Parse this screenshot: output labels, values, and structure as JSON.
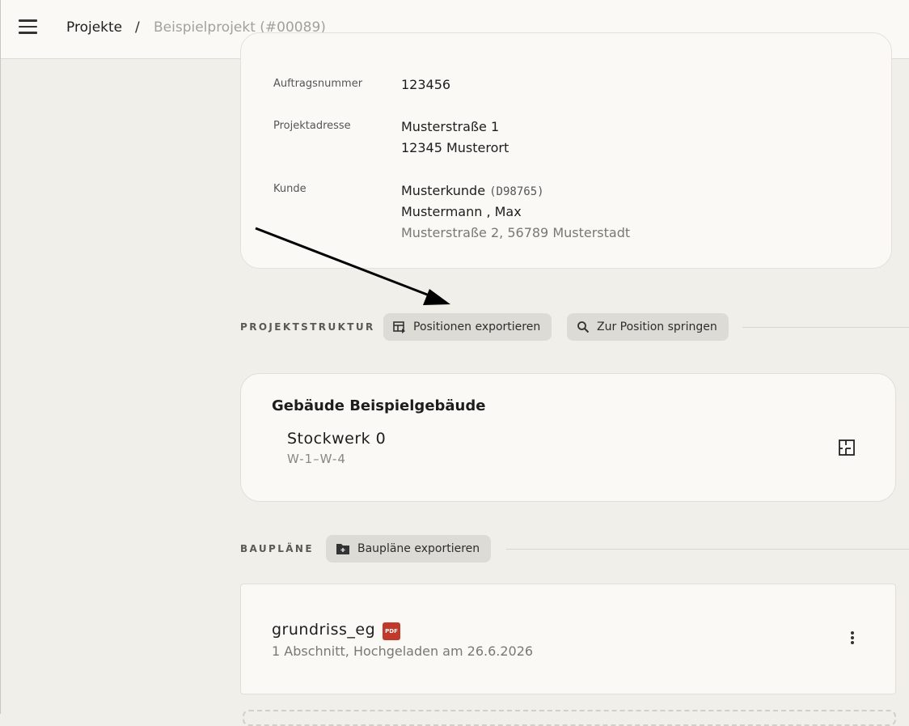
{
  "header": {
    "breadcrumb_home": "Projekte",
    "breadcrumb_separator": "/",
    "breadcrumb_current": "Beispielprojekt (#00089)"
  },
  "project_info": {
    "order_number_label": "Auftragsnummer",
    "order_number": "123456",
    "address_label": "Projektadresse",
    "address_line1": "Musterstraße 1",
    "address_line2": "12345 Musterort",
    "customer_label": "Kunde",
    "customer_name": "Musterkunde",
    "customer_id": "(D98765)",
    "contact": "Mustermann , Max",
    "customer_address": "Musterstraße 2, 56789 Musterstadt"
  },
  "structure": {
    "section_label": "PROJEKTSTRUKTUR",
    "export_button": "Positionen exportieren",
    "jump_button": "Zur Position springen",
    "building_title": "Gebäude Beispielgebäude",
    "floor_name": "Stockwerk 0",
    "floor_range": "W-1–W-4"
  },
  "plans": {
    "section_label": "BAUPLÄNE",
    "export_button": "Baupläne exportieren",
    "items": [
      {
        "name": "grundriss_eg",
        "file_type": "PDF",
        "meta": "1 Abschnitt, Hochgeladen am 26.6.2026"
      }
    ]
  },
  "colors": {
    "background": "#f1efea",
    "card": "#faf9f6",
    "chip": "#dcdbd6",
    "pdf_badge": "#c0392b"
  }
}
